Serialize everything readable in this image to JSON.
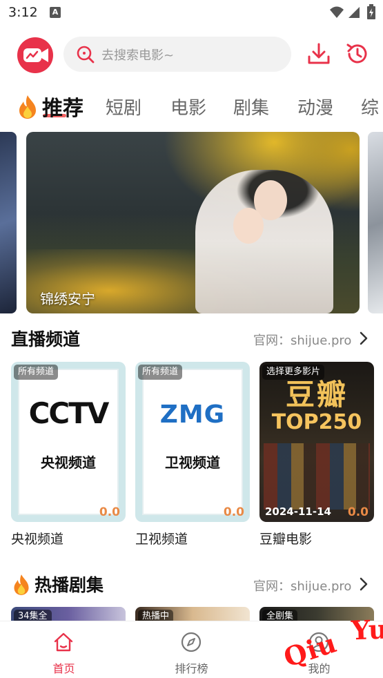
{
  "status_bar": {
    "time": "3:12",
    "notification_badge": "A"
  },
  "header": {
    "search_placeholder": "去搜索电影~",
    "icons": [
      "app-logo-icon",
      "search-icon",
      "download-icon",
      "history-icon"
    ],
    "accent_color": "#e8324a"
  },
  "tabs": [
    {
      "label": "推荐",
      "active": true
    },
    {
      "label": "短剧"
    },
    {
      "label": "电影"
    },
    {
      "label": "剧集"
    },
    {
      "label": "动漫"
    },
    {
      "label": "综"
    }
  ],
  "banner": {
    "caption": "锦绣安宁"
  },
  "live_section": {
    "title": "直播频道",
    "site_link": "官网：shijue.pro",
    "cards": [
      {
        "badge": "所有频道",
        "logo": "CCTV",
        "name": "央视频道",
        "score": "0.0",
        "label": "央视频道"
      },
      {
        "badge": "所有频道",
        "logo": "ZMG",
        "name": "卫视频道",
        "score": "0.0",
        "label": "卫视频道"
      },
      {
        "badge": "选择更多影片",
        "big": "豆瓣",
        "top": "TOP250",
        "date": "2024-11-14",
        "score": "0.0",
        "label": "豆瓣电影"
      }
    ]
  },
  "hot_section": {
    "title": "热播剧集",
    "site_link": "官网：shijue.pro",
    "cards": [
      {
        "badge": "34集全"
      },
      {
        "badge": "热播中"
      },
      {
        "badge": "全剧集"
      }
    ]
  },
  "bottom_nav": [
    {
      "label": "首页",
      "icon": "home-icon",
      "active": true
    },
    {
      "label": "排行榜",
      "icon": "compass-icon"
    },
    {
      "label": "我的",
      "icon": "profile-icon"
    }
  ],
  "watermark": "Qiu Yue"
}
